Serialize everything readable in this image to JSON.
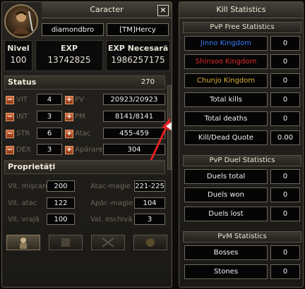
{
  "character_window": {
    "title": "Caracter",
    "close_label": "✕",
    "name": "diamondbro",
    "guild": "[TM]Hercy",
    "level_label": "Nivel",
    "level": "100",
    "exp_label": "EXP",
    "exp": "13742825",
    "exp_needed_label": "EXP Necesară",
    "exp_needed": "1986257175",
    "status": {
      "title": "Status",
      "points": "270",
      "stats": [
        {
          "label": "VIT",
          "value": "4",
          "sub_label": "PV",
          "sub_value": "20923/20923"
        },
        {
          "label": "INT",
          "value": "3",
          "sub_label": "PM",
          "sub_value": "8141/8141"
        },
        {
          "label": "STR",
          "value": "6",
          "sub_label": "Atac",
          "sub_value": "455-459"
        },
        {
          "label": "DEX",
          "value": "3",
          "sub_label": "Apărare",
          "sub_value": "304"
        }
      ]
    },
    "properties": {
      "title": "Proprietăți",
      "items": [
        {
          "label": "Vit. mișcare",
          "value": "200",
          "label2": "Atac-magie",
          "value2": "221-225"
        },
        {
          "label": "Vit. atac",
          "value": "122",
          "label2": "Apăr.-magie",
          "value2": "104"
        },
        {
          "label": "Vit. vrajă",
          "value": "100",
          "label2": "Val. eschivă",
          "value2": "3"
        }
      ]
    },
    "tabs": [
      "character-tab",
      "skills-tab",
      "emotions-tab",
      "quests-tab"
    ]
  },
  "kill_statistics": {
    "title": "Kill Statistics",
    "pvp_free": {
      "title": "PvP Free Statistics",
      "rows": [
        {
          "label": "Jinno Kingdom",
          "value": "0",
          "color": "#3a7bff"
        },
        {
          "label": "Shinsoo Kingdom",
          "value": "0",
          "color": "#e02a2a"
        },
        {
          "label": "Chunjo Kingdom",
          "value": "0",
          "color": "#d8b23a"
        },
        {
          "label": "Total kills",
          "value": "0",
          "color": "#f0f0f0"
        },
        {
          "label": "Total deaths",
          "value": "0",
          "color": "#f0f0f0"
        },
        {
          "label": "Kill/Dead Quote",
          "value": "0.00",
          "color": "#f0f0f0"
        }
      ]
    },
    "pvp_duel": {
      "title": "PvP Duel Statistics",
      "rows": [
        {
          "label": "Duels total",
          "value": "0"
        },
        {
          "label": "Duels won",
          "value": "0"
        },
        {
          "label": "Duels lost",
          "value": "0"
        }
      ]
    },
    "pvm": {
      "title": "PvM Statistics",
      "rows": [
        {
          "label": "Bosses",
          "value": "0"
        },
        {
          "label": "Stones",
          "value": "0"
        }
      ]
    }
  }
}
